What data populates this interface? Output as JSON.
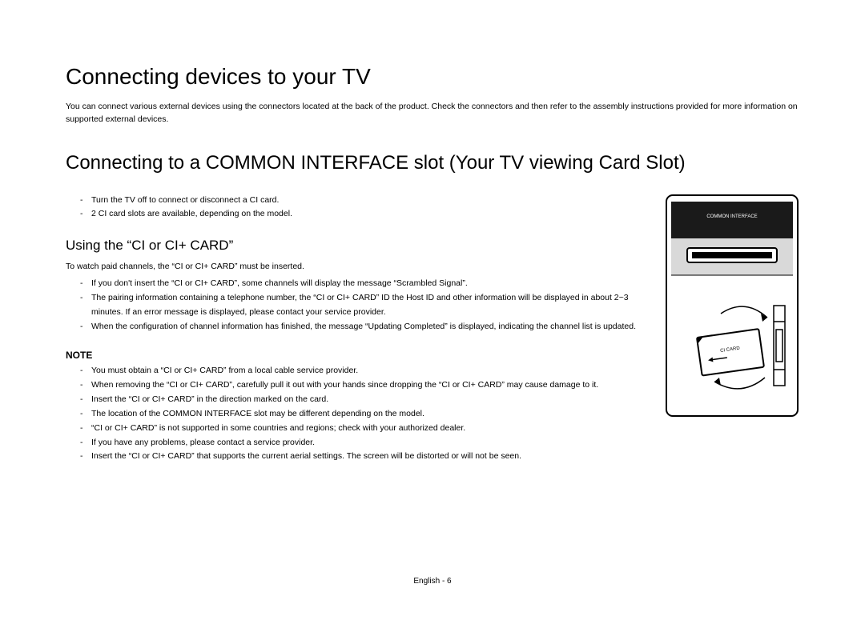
{
  "h1": "Connecting devices to your TV",
  "intro": "You can connect various external devices using the connectors located at the back of the product. Check the connectors and then refer to the assembly instructions provided for more information on supported external devices.",
  "h2": "Connecting to a COMMON INTERFACE slot (Your TV viewing Card Slot)",
  "bullets_top": [
    "Turn the TV off to connect or disconnect a CI card.",
    "2 CI card slots are available, depending on the model."
  ],
  "h3": "Using the “CI or CI+ CARD”",
  "using_intro": "To watch paid channels, the “CI or CI+ CARD” must be inserted.",
  "using_bullets": [
    "If you don't insert the “CI or CI+ CARD”, some channels will display the message “Scrambled Signal”.",
    "The pairing information containing a telephone number, the “CI or CI+ CARD” ID the Host ID and other information will be displayed in about 2~3 minutes. If an error message is displayed, please contact your service provider.",
    "When the configuration of channel information has finished, the message “Updating Completed” is displayed, indicating the channel list is updated."
  ],
  "note_label": "NOTE",
  "note_bullets": [
    "You must obtain a “CI or CI+ CARD” from a local cable service provider.",
    "When removing the “CI or CI+ CARD”, carefully pull it out with your hands since dropping the “CI or CI+ CARD” may cause damage to it.",
    "Insert the “CI or CI+ CARD” in the direction marked on the card.",
    "The location of the COMMON INTERFACE slot may be different depending on the model.",
    "“CI or CI+ CARD” is not supported in some countries and regions; check with your authorized dealer.",
    "If you have any problems, please contact a service provider.",
    "Insert the “CI or CI+ CARD” that supports the current aerial settings. The screen will be distorted or will not be seen."
  ],
  "diagram": {
    "label_top": "COMMON INTERFACE",
    "card_label": "CI CARD"
  },
  "footer": "English - 6"
}
